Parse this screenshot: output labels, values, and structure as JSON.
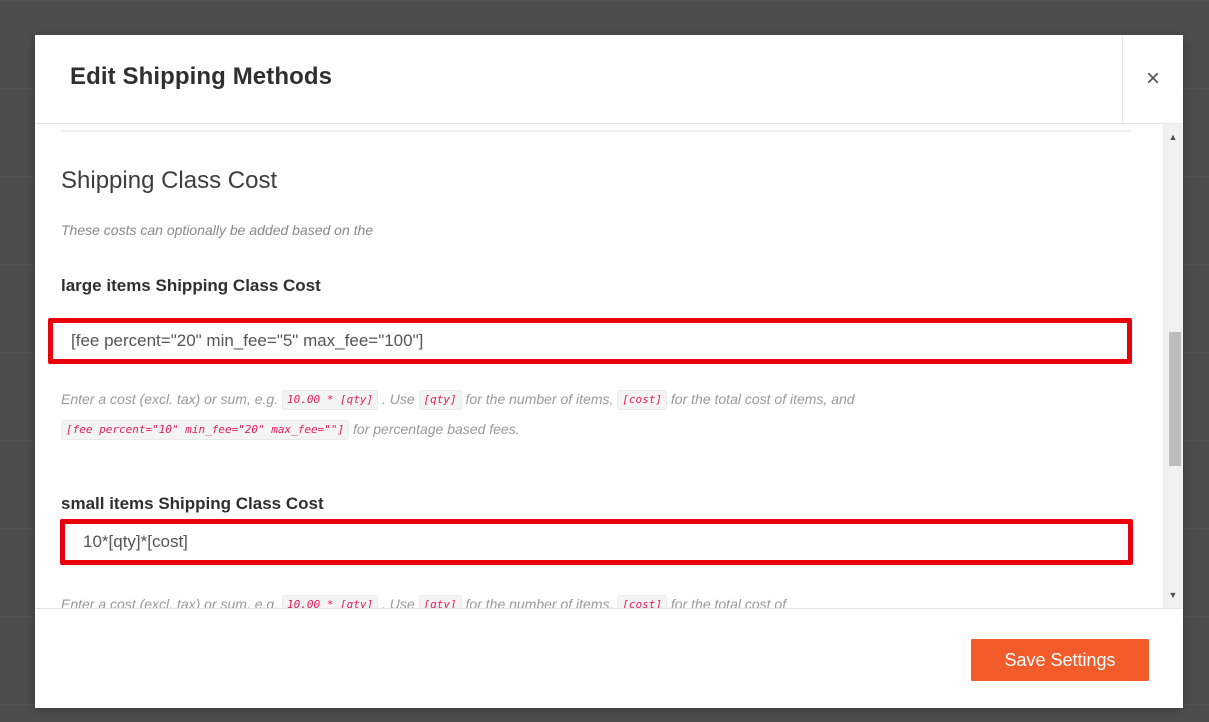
{
  "modal": {
    "title": "Edit Shipping Methods",
    "close_symbol": "×"
  },
  "section": {
    "title": "Shipping Class Cost",
    "description": "These costs can optionally be added based on the"
  },
  "fields": [
    {
      "label": "large items Shipping Class Cost",
      "value": "[fee percent=\"20\" min_fee=\"5\" max_fee=\"100\"]",
      "help": {
        "part1": "Enter a cost (excl. tax) or sum, e.g.",
        "code1": "10.00 * [qty]",
        "part2": ". Use",
        "code2": "[qty]",
        "part3": "for the number of items,",
        "code3": "[cost]",
        "part4": "for the total cost of items, and",
        "code4": "[fee percent=\"10\" min_fee=\"20\" max_fee=\"\"]",
        "part5": "for percentage based fees."
      }
    },
    {
      "label": "small items Shipping Class Cost",
      "value": "10*[qty]*[cost]",
      "help": {
        "part1": "Enter a cost (excl. tax) or sum, e.g.",
        "code1": "10.00 * [qty]",
        "part2": ". Use",
        "code2": "[qty]",
        "part3": "for the number of items,",
        "code3": "[cost]",
        "part4": "for the total cost of"
      }
    }
  ],
  "footer": {
    "save_label": "Save Settings"
  },
  "colors": {
    "highlight_border": "#e8000b",
    "save_button": "#f25c2a"
  },
  "icons": {
    "close": "close-icon",
    "scroll_up": "scroll-up-arrow-icon",
    "scroll_down": "scroll-down-arrow-icon"
  }
}
